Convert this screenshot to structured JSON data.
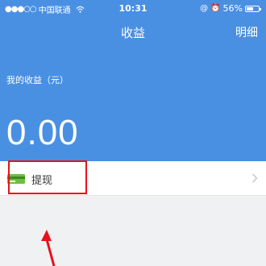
{
  "status_bar": {
    "signal": "●●●○○",
    "carrier": "中国联通",
    "wifi_icon": "wifi-icon",
    "time": "10:31",
    "lock_glyph": "@",
    "alarm_glyph": "⏰",
    "battery_percent": "56%",
    "battery_level": 0.56
  },
  "header": {
    "title": "收益",
    "detail_label": "明细"
  },
  "income": {
    "label": "我的收益（元）",
    "amount": "0.00"
  },
  "withdraw": {
    "icon": "wallet-icon",
    "label": "提现",
    "chevron": "chevron-right-icon"
  },
  "annotation": {
    "box_color": "#e8111a",
    "arrow_color": "#e8111a"
  },
  "colors": {
    "header_blue": "#4a90e2",
    "background": "#f0f1f3",
    "row_text": "#333333"
  }
}
